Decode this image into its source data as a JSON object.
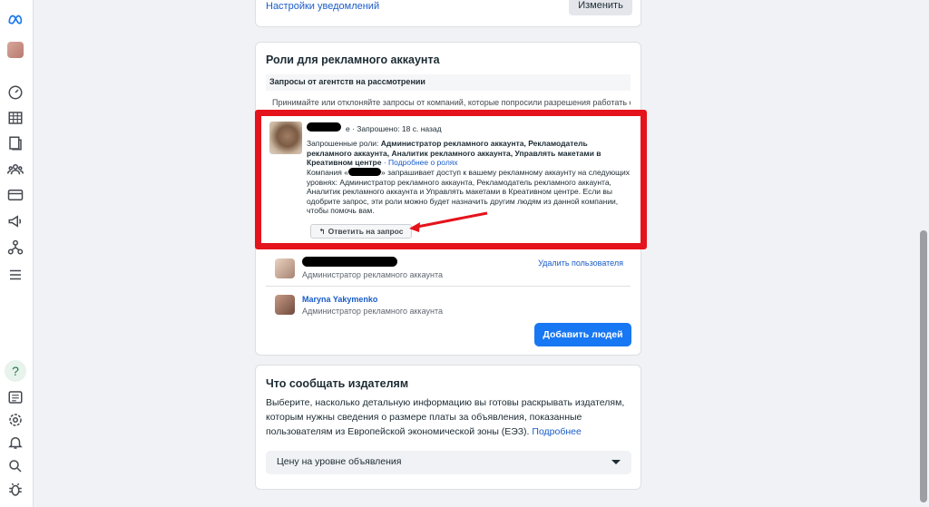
{
  "top_card": {
    "notifications_link": "Настройки уведомлений",
    "change_button": "Изменить"
  },
  "roles_card": {
    "title": "Роли для рекламного аккаунта",
    "pending_header": "Запросы от агентств на рассмотрении",
    "accept_text": "Принимайте или отклоняйте запросы от компаний, которые попросили разрешения работать с",
    "request": {
      "requested_prefix": "е",
      "requested_time": "· Запрошено: 18 с. назад",
      "requested_roles_label": "Запрошенные роли:",
      "requested_roles": "Администратор рекламного аккаунта, Рекламодатель рекламного аккаунта, Аналитик рекламного аккаунта, Управлять макетами в Креативном центре",
      "roles_link": "· Подробнее о ролях",
      "company_prefix": "Компания «",
      "company_text": "» запрашивает доступ к вашему рекламному аккаунту на следующих уровнях: Администратор рекламного аккаунта, Рекламодатель рекламного аккаунта, Аналитик рекламного аккаунта и Управлять макетами в Креативном центре. Если вы одобрите запрос, эти роли можно будет назначить другим людям из данной компании, чтобы помочь вам.",
      "reply_button": "Ответить на запрос"
    },
    "users": [
      {
        "name": "",
        "role": "Администратор рекламного аккаунта",
        "action": "Удалить пользователя"
      },
      {
        "name": "Maryna Yakymenko",
        "role": "Администратор рекламного аккаунта",
        "action": ""
      }
    ],
    "add_people_button": "Добавить людей"
  },
  "publishers_card": {
    "title": "Что сообщать издателям",
    "description": "Выберите, насколько детальную информацию вы готовы раскрывать издателям, которым нужны сведения о размере платы за объявления, показанные пользователям из Европейской экономической зоны (ЕЭЗ).",
    "more_link": "Подробнее",
    "select_value": "Цену на уровне объявления"
  },
  "rail_icons": [
    "meta-logo-icon",
    "avatar",
    "gauge-icon",
    "table-icon",
    "pages-icon",
    "audience-icon",
    "billing-icon",
    "megaphone-icon",
    "tree-icon",
    "menu-icon",
    "help-icon",
    "news-icon",
    "gear-icon",
    "bell-icon",
    "search-icon",
    "bug-icon"
  ],
  "colors": {
    "accent": "#1877f2",
    "highlight": "#e5131c"
  }
}
